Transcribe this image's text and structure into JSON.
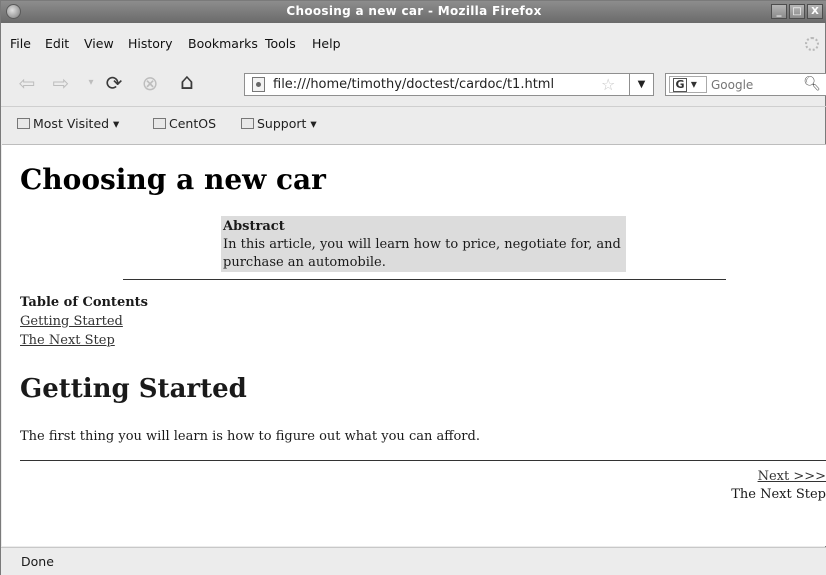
{
  "window": {
    "title": "Choosing a new car - Mozilla Firefox",
    "buttons": [
      "_",
      "□",
      "X"
    ]
  },
  "menu": [
    "File",
    "Edit",
    "View",
    "History",
    "Bookmarks",
    "Tools",
    "Help"
  ],
  "toolbar": {
    "url": "file:///home/timothy/doctest/cardoc/t1.html",
    "search_placeholder": "Google",
    "icons": [
      "back-icon",
      "forward-icon",
      "history-dropdown-icon",
      "reload-icon",
      "stop-icon",
      "home-icon"
    ]
  },
  "bookmarks": [
    "Most Visited ▾",
    "CentOS",
    "Support ▾"
  ],
  "page": {
    "title": "Choosing a new car",
    "abstract_heading": "Abstract",
    "abstract_text": "In this article, you will learn how to price, negotiate for, and purchase an automobile.",
    "toc_heading": "Table of Contents",
    "toc": [
      "Getting Started",
      "The Next Step"
    ],
    "section_title": "Getting Started",
    "paragraph": "The first thing you will learn is how to figure out what you can afford.",
    "next_link": "Next >>>",
    "next_title": "The Next Step"
  },
  "status": "Done"
}
